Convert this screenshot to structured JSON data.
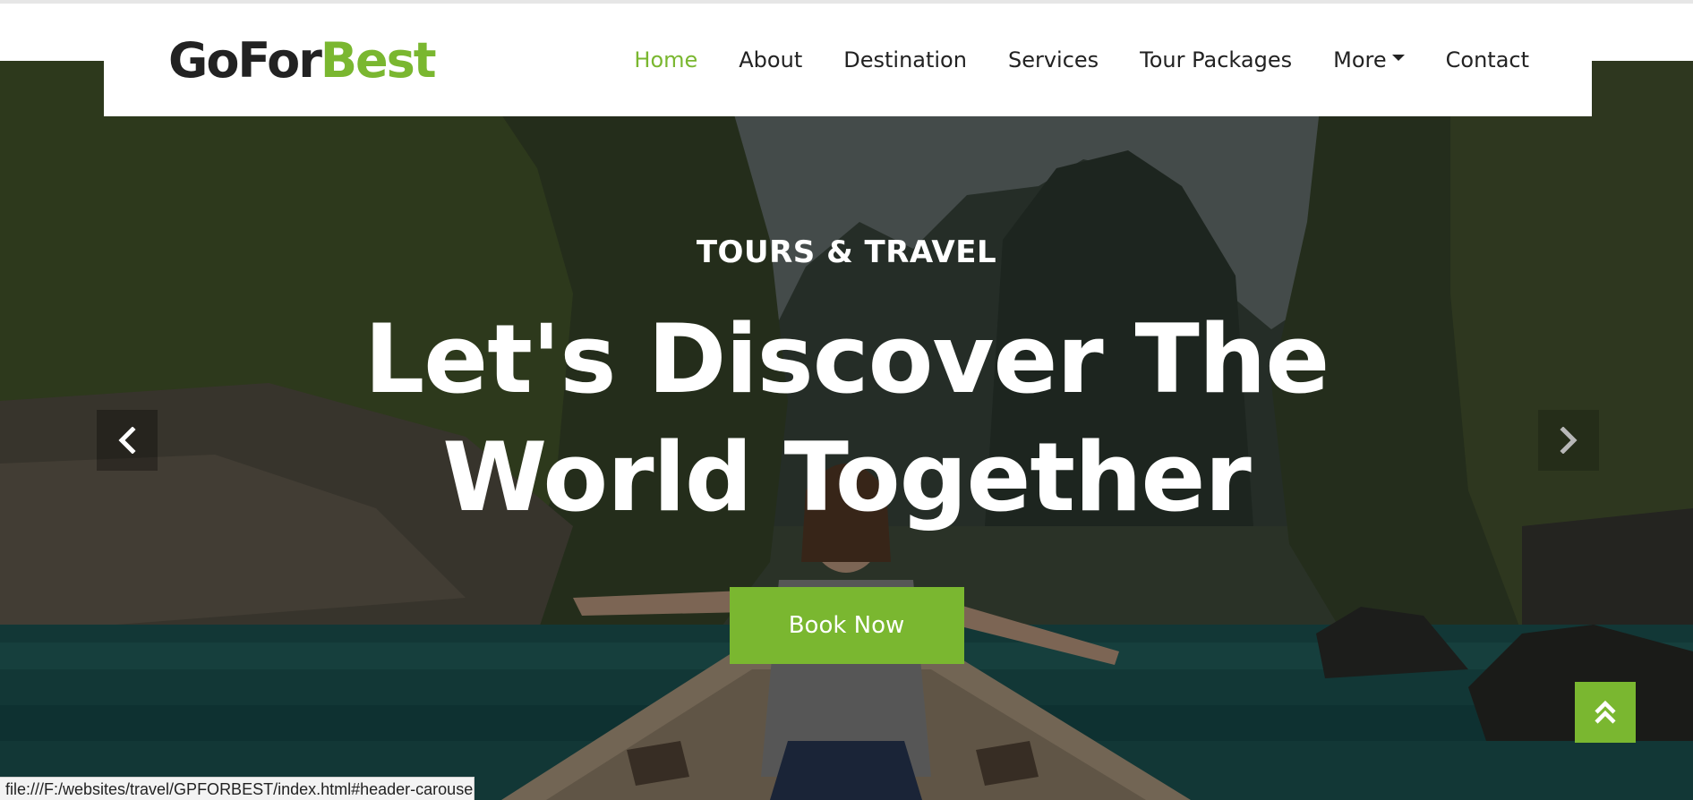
{
  "brand": {
    "logo_part1": "GoFor",
    "logo_part2": "Best",
    "accent_color": "#7ab730"
  },
  "nav": {
    "items": [
      {
        "label": "Home",
        "active": true
      },
      {
        "label": "About"
      },
      {
        "label": "Destination"
      },
      {
        "label": "Services"
      },
      {
        "label": "Tour Packages"
      },
      {
        "label": "More",
        "dropdown": true
      },
      {
        "label": "Contact"
      }
    ]
  },
  "hero": {
    "eyebrow": "TOURS & TRAVEL",
    "headline_line1": "Let's Discover The",
    "headline_line2": "World Together",
    "cta_label": "Book Now"
  },
  "carousel": {
    "prev_icon": "chevron-left-icon",
    "next_icon": "chevron-right-icon"
  },
  "back_to_top": {
    "icon": "double-chevron-up-icon"
  },
  "status_bar": {
    "url": "file:///F:/websites/travel/GPFORBEST/index.html#header-carousel"
  }
}
